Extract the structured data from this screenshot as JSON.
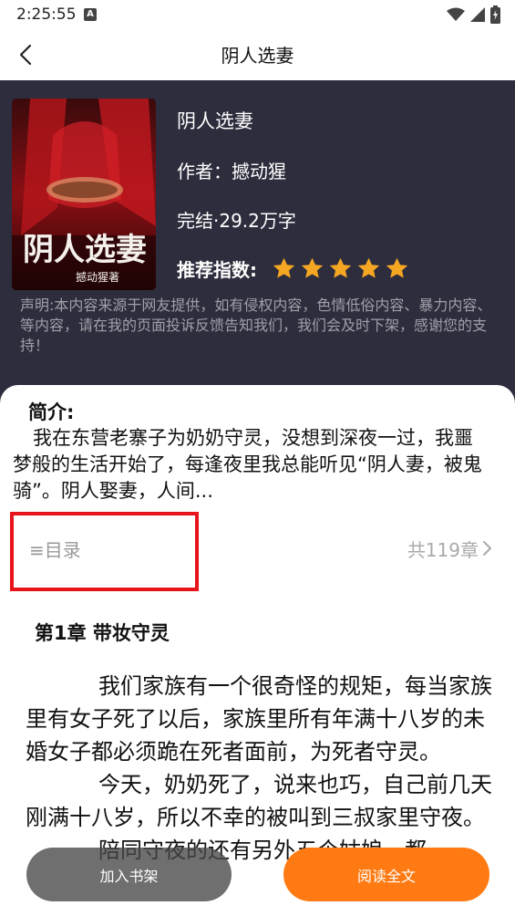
{
  "status_bar": {
    "time": "2:25:55",
    "notification_badge": "A",
    "icons": [
      "wifi-icon",
      "signal-icon",
      "battery-icon"
    ]
  },
  "header": {
    "title": "阴人选妻"
  },
  "book": {
    "title": "阴人选妻",
    "author": "作者：撼动猩",
    "status_words": "完结·29.2万字",
    "rating_label": "推荐指数:",
    "rating_stars": 5,
    "cover_title": "阴人选妻",
    "cover_author": "撼动猩著",
    "disclaimer": "声明:本内容来源于网友提供，如有侵权内容，色情低俗内容、暴力内容、等内容，请在我的页面投诉反馈告知我们，我们会及时下架，感谢您的支持！"
  },
  "intro": {
    "heading": "简介:",
    "text": "我在东营老寨子为奶奶守灵，没想到深夜一过，我噩梦般的生活开始了，每逢夜里我总能听见“阴人妻，被鬼骑”。阴人娶妻，人间..."
  },
  "toc": {
    "label": "≡目录",
    "count": "共119章"
  },
  "chapter": {
    "title": "第1章 带妆守灵",
    "paragraphs": [
      "我们家族有一个很奇怪的规矩，每当家族里有女子死了以后，家族里所有年满十八岁的未婚女子都必须跪在死者面前，为死者守灵。",
      "今天，奶奶死了，说来也巧，自己前几天刚满十八岁，所以不幸的被叫到三叔家里守夜。",
      "陪同守夜的还有另外五个姑娘，都"
    ]
  },
  "buttons": {
    "add_shelf": "加入书架",
    "read_full": "阅读全文"
  },
  "colors": {
    "info_bg": "#2d2d3d",
    "star": "#f5a623",
    "read_button": "#ff7a12",
    "highlight": "#e8141b"
  }
}
